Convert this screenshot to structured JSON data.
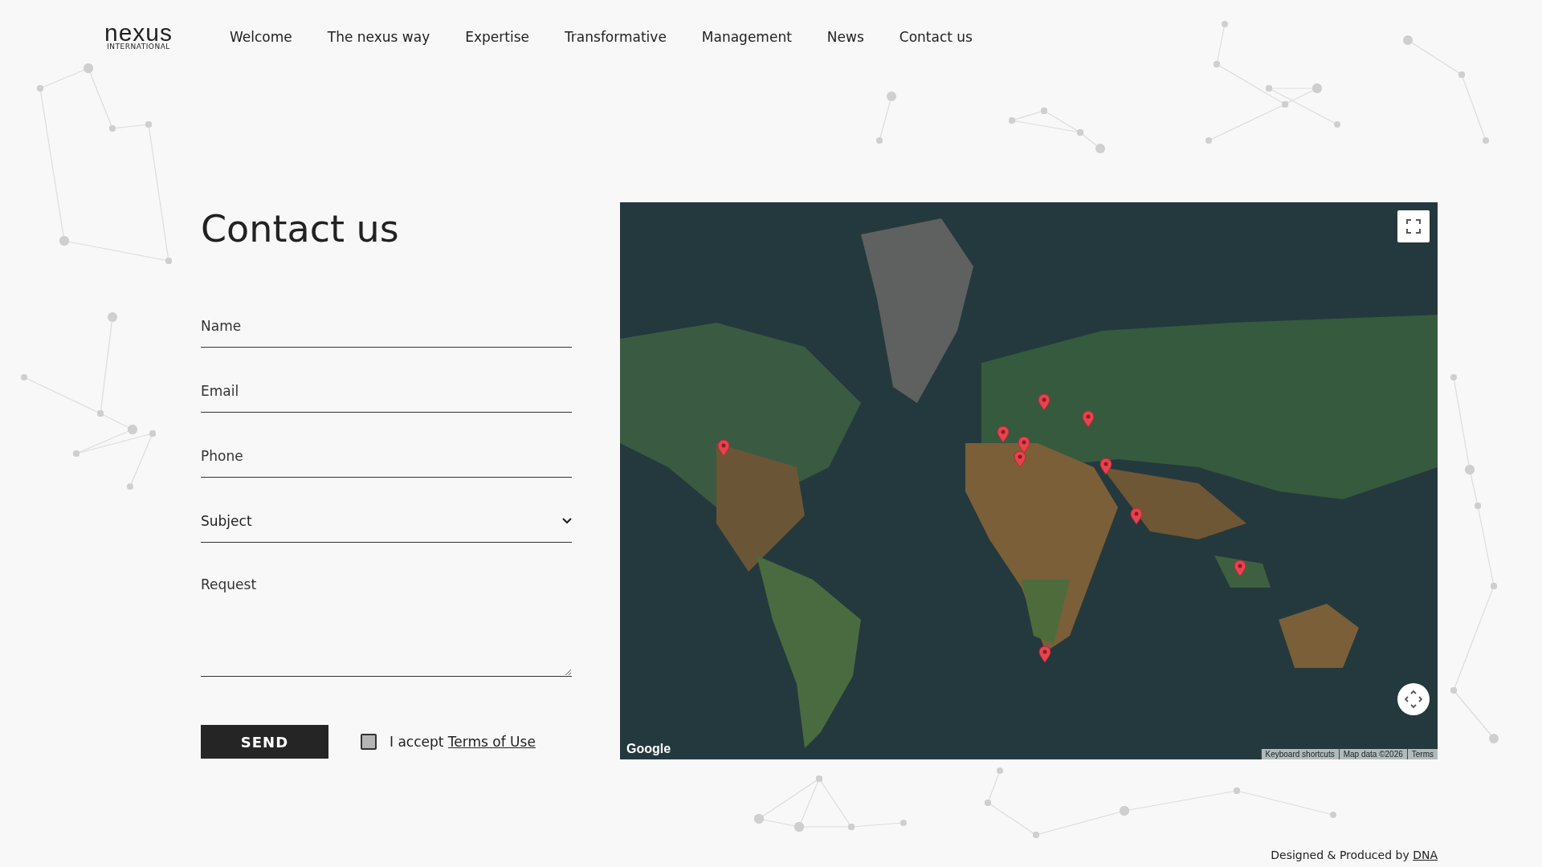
{
  "logo": {
    "name": "nexus",
    "tagline": "INTERNATIONAL"
  },
  "nav": [
    {
      "label": "Welcome",
      "selected": false
    },
    {
      "label": "The nexus way",
      "selected": false
    },
    {
      "label": "Expertise",
      "selected": false
    },
    {
      "label": "Transformative",
      "selected": false
    },
    {
      "label": "Management",
      "selected": false
    },
    {
      "label": "News",
      "selected": false
    },
    {
      "label": "Contact us",
      "selected": false
    }
  ],
  "heading": "Contact us",
  "form": {
    "fields": [
      {
        "kind": "input",
        "placeholder": "Name"
      },
      {
        "kind": "input",
        "placeholder": "Email"
      },
      {
        "kind": "input",
        "placeholder": "Phone"
      },
      {
        "kind": "select",
        "placeholder": "Subject"
      },
      {
        "kind": "textarea",
        "placeholder": "Request"
      }
    ],
    "send": "SEND",
    "terms": {
      "checked": false,
      "text": "I accept",
      "link": "Terms of Use"
    }
  },
  "map": {
    "kind": "picture",
    "google_logo": "Google",
    "attribution": [
      "Keyboard shortcuts",
      "Map data ©2026",
      "Terms"
    ]
  },
  "footer": {
    "text": "Designed & Produced by",
    "link": "DNA"
  }
}
